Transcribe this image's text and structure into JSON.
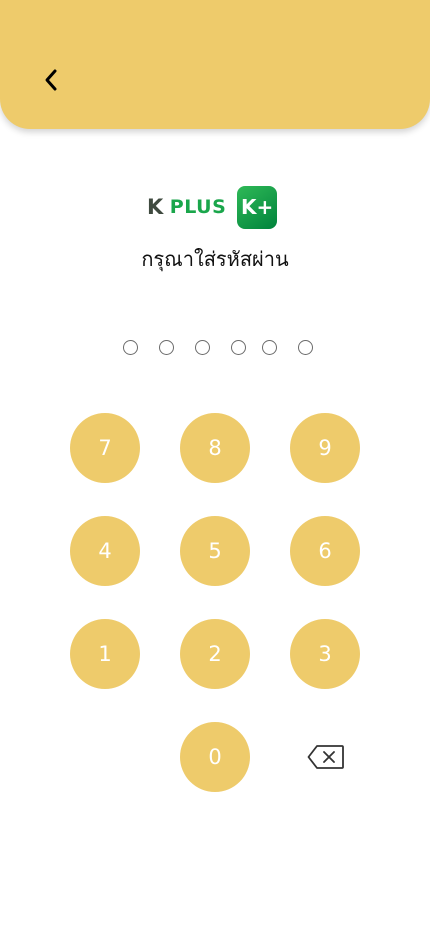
{
  "header": {
    "back_icon": "chevron-left-icon",
    "accent_color": "#eecb6b"
  },
  "logo": {
    "k_mark": "K",
    "wordmark": "PLUS",
    "badge_text": "K+",
    "brand_green": "#1aa64b"
  },
  "prompt": {
    "text": "กรุณาใส่รหัสผ่าน"
  },
  "pin": {
    "length": 6,
    "entered": 0
  },
  "keypad": {
    "keys": [
      {
        "label": "7"
      },
      {
        "label": "8"
      },
      {
        "label": "9"
      },
      {
        "label": "4"
      },
      {
        "label": "5"
      },
      {
        "label": "6"
      },
      {
        "label": "1"
      },
      {
        "label": "2"
      },
      {
        "label": "3"
      },
      {
        "label": "0"
      }
    ],
    "delete_icon": "backspace-icon"
  }
}
